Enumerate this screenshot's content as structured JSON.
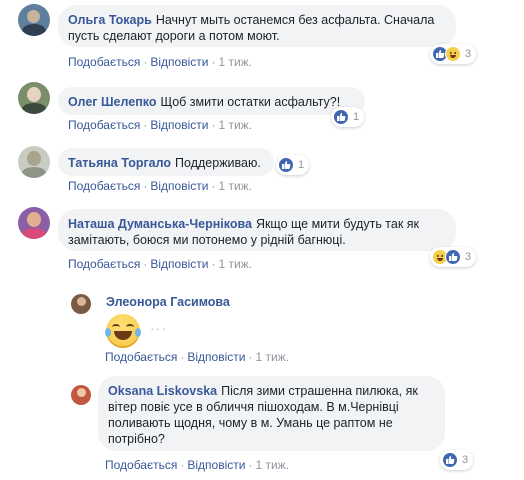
{
  "comments": [
    {
      "author": "Ольга Токарь",
      "text": "Начнут мыть останемся без асфальта. Сначала пусть сделают дороги а потом моют.",
      "actions": {
        "like": "Подобається",
        "reply": "Відповісти",
        "time": "1 тиж."
      },
      "reactions": {
        "icons": [
          "like",
          "haha"
        ],
        "count": "3"
      }
    },
    {
      "author": "Олег Шелепко",
      "text": "Щоб змити остатки асфальту?!",
      "actions": {
        "like": "Подобається",
        "reply": "Відповісти",
        "time": "1 тиж."
      },
      "reactions": {
        "icons": [
          "like"
        ],
        "count": "1"
      }
    },
    {
      "author": "Татьяна Торгало",
      "text": "Поддерживаю.",
      "actions": {
        "like": "Подобається",
        "reply": "Відповісти",
        "time": "1 тиж."
      },
      "reactions": {
        "icons": [
          "like"
        ],
        "count": "1"
      }
    },
    {
      "author": "Наташа Думанська-Чернікова",
      "text": "Якщо ще мити будуть так як замітають, боюся ми потонемо у рідній багнюці.",
      "actions": {
        "like": "Подобається",
        "reply": "Відповісти",
        "time": "1 тиж."
      },
      "reactions": {
        "icons": [
          "haha",
          "like"
        ],
        "count": "3"
      }
    }
  ],
  "replies": [
    {
      "author": "Элеонора Гасимова",
      "sticker": "laughing-tears-emoji",
      "more": "···",
      "actions": {
        "like": "Подобається",
        "reply": "Відповісти",
        "time": "1 тиж."
      }
    },
    {
      "author": "Oksana Liskovska",
      "text": "Після зими страшенна пилюка, як вітер повіє усе в обличчя пішоходам. В м.Чернівці поливають щодня, чому в м. Умань це раптом не потрібно?",
      "actions": {
        "like": "Подобається",
        "reply": "Відповісти",
        "time": "1 тиж."
      },
      "reactions": {
        "icons": [
          "like"
        ],
        "count": "3"
      }
    }
  ],
  "separator": "·",
  "colors": {
    "link": "#385898",
    "bubble": "#f2f3f5",
    "like": "#4267b2",
    "haha": "#f7d04b"
  }
}
